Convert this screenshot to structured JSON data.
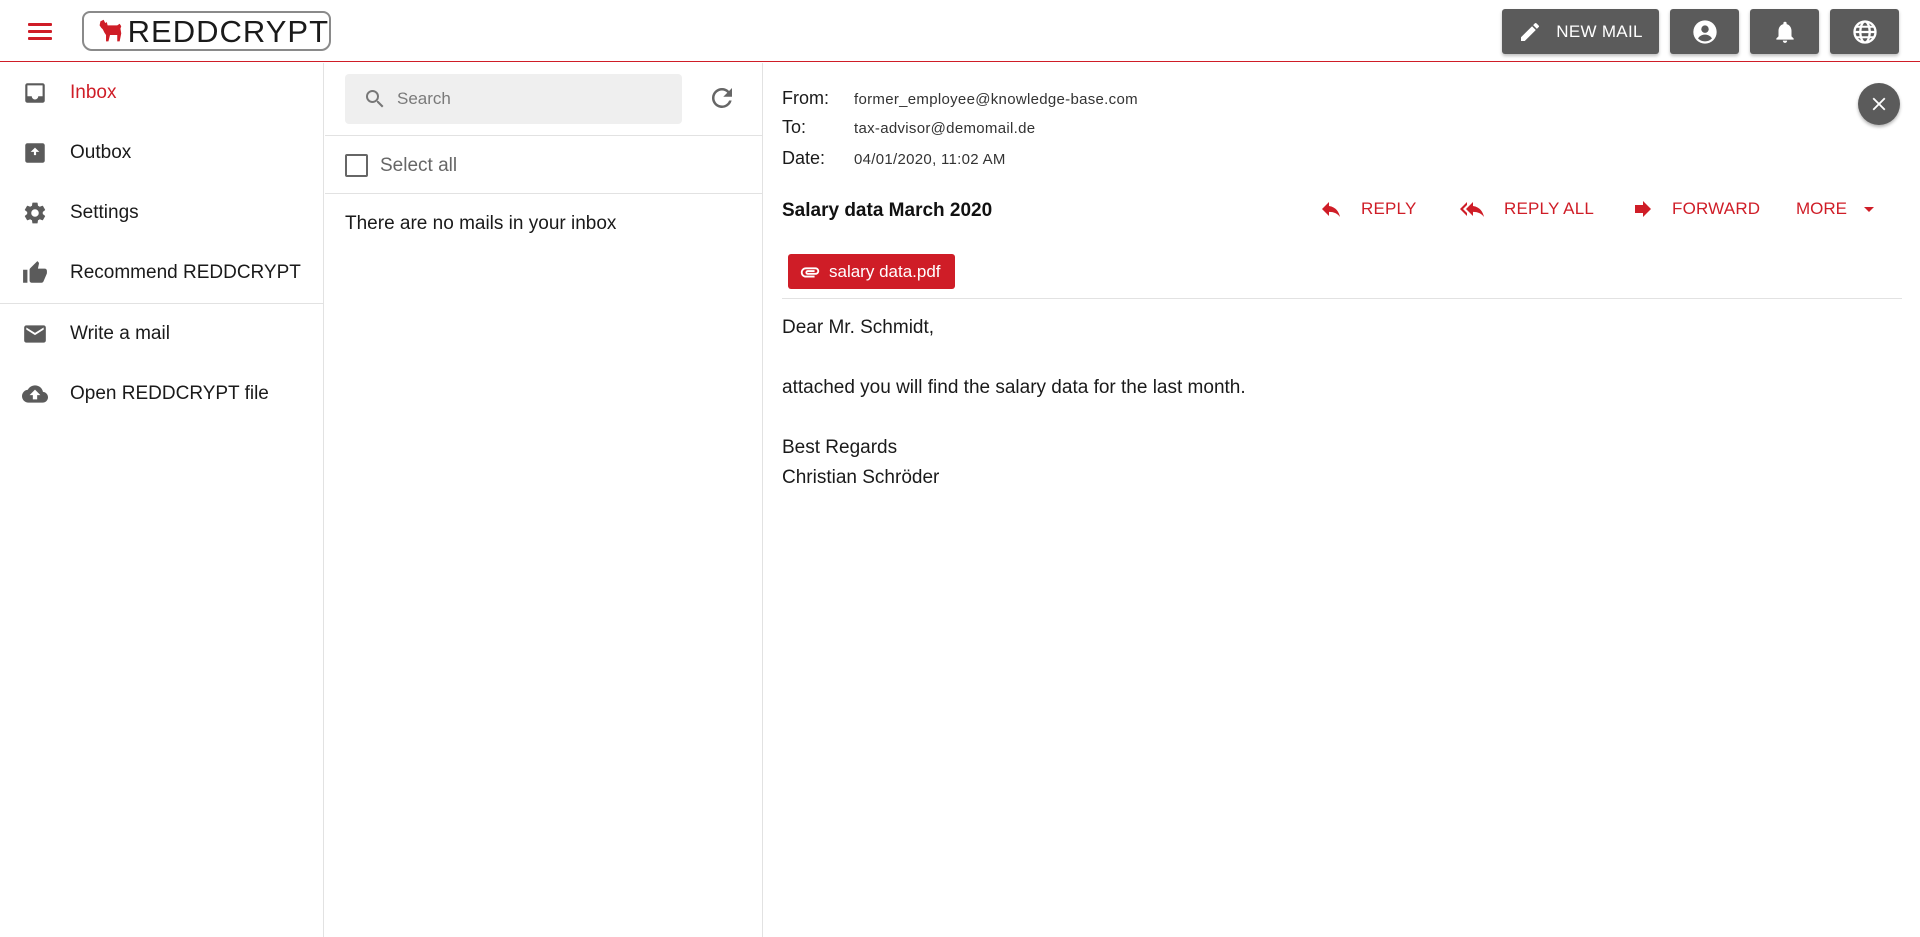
{
  "app": {
    "logo_text": "REDDCRYPT",
    "brand_color": "#cf1d27",
    "button_color": "#5b5b5b"
  },
  "header": {
    "menu_icon": "hamburger-menu-icon",
    "new_mail_label": "NEW MAIL",
    "new_mail_icon": "pencil-icon",
    "account_icon": "account-circle-icon",
    "notifications_icon": "bell-icon",
    "language_icon": "globe-icon"
  },
  "sidebar": {
    "items": [
      {
        "label": "Inbox",
        "icon": "inbox-icon",
        "active": true
      },
      {
        "label": "Outbox",
        "icon": "outbox-icon",
        "active": false
      },
      {
        "label": "Settings",
        "icon": "gear-icon",
        "active": false
      },
      {
        "label": "Recommend REDDCRYPT",
        "icon": "thumbs-up-icon",
        "active": false
      },
      {
        "label": "Write a mail",
        "icon": "envelope-icon",
        "active": false
      },
      {
        "label": "Open REDDCRYPT file",
        "icon": "cloud-upload-icon",
        "active": false
      }
    ]
  },
  "mail_list": {
    "search_placeholder": "Search",
    "search_value": "",
    "select_all_label": "Select all",
    "select_all_checked": false,
    "empty_message": "There are no mails in your inbox"
  },
  "message": {
    "from_label": "From:",
    "from": "former_employee@knowledge-base.com",
    "to_label": "To:",
    "to": "tax-advisor@demomail.de",
    "date_label": "Date:",
    "date": "04/01/2020, 11:02 AM",
    "subject": "Salary data March 2020",
    "actions": {
      "reply": "REPLY",
      "reply_all": "REPLY ALL",
      "forward": "FORWARD",
      "more": "MORE"
    },
    "attachment": "salary data.pdf",
    "body": {
      "greeting": "Dear Mr. Schmidt,",
      "line1": "attached you will find the salary data for the last month.",
      "closing": "Best Regards",
      "signature": "Christian Schröder"
    }
  }
}
